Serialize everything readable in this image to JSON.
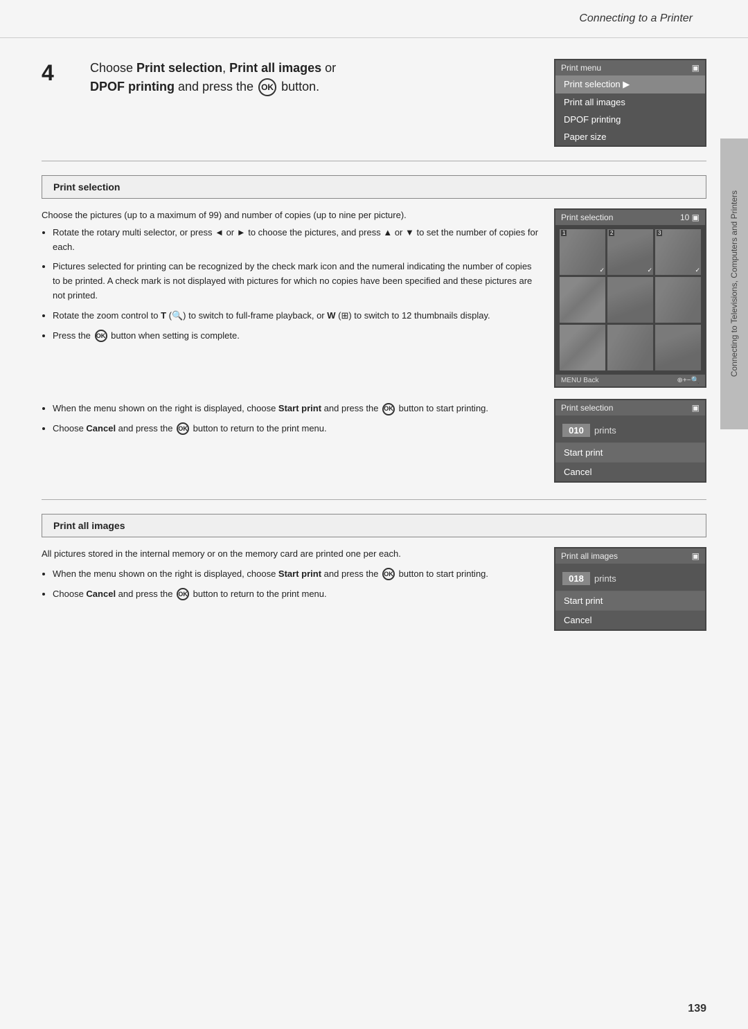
{
  "header": {
    "title": "Connecting to a Printer"
  },
  "right_tab": {
    "text": "Connecting to Televisions, Computers and Printers"
  },
  "step4": {
    "number": "4",
    "text_intro": "Choose ",
    "bold1": "Print selection",
    "comma": ", ",
    "bold2": "Print all images",
    "text_or": " or",
    "bold3": "DPOF printing",
    "text_end": " and press the",
    "ok_symbol": "OK",
    "text_end2": "button."
  },
  "print_menu_screen": {
    "header": "Print menu",
    "items": [
      {
        "label": "Print selection",
        "selected": true,
        "has_arrow": true
      },
      {
        "label": "Print all images",
        "selected": false
      },
      {
        "label": "DPOF printing",
        "selected": false
      },
      {
        "label": "Paper size",
        "selected": false
      }
    ]
  },
  "print_selection_section": {
    "title": "Print selection",
    "description": "Choose the pictures (up to a maximum of 99) and number of copies (up to nine per picture).",
    "bullets": [
      "Rotate the rotary multi selector, or press ◄ or ► to choose the pictures, and press ▲ or ▼ to set the number of copies for each.",
      "Pictures selected for printing can be recognized by the check mark icon and the numeral indicating the number of copies to be printed. A check mark is not displayed with pictures for which no copies have been specified and these pictures are not printed.",
      "Rotate the zoom control to T (🔍) to switch to full-frame playback, or W (🔲) to switch to 12 thumbnails display.",
      "Press the OK button when setting is complete."
    ],
    "thumb_screen": {
      "header_label": "Print selection",
      "count": "10",
      "thumbnails": [
        {
          "num": "1",
          "has_check": true
        },
        {
          "num": "2",
          "has_check": true
        },
        {
          "num": "3",
          "has_check": true
        },
        {
          "num": "",
          "has_check": false
        },
        {
          "num": "",
          "has_check": false
        },
        {
          "num": "",
          "has_check": false
        },
        {
          "num": "",
          "has_check": false
        },
        {
          "num": "",
          "has_check": false
        },
        {
          "num": "",
          "has_check": false
        }
      ],
      "footer_left": "MENU Back",
      "footer_right": "⊕+−🔍"
    }
  },
  "print_selection_confirm": {
    "bullets": [
      "When the menu shown on the right is displayed, choose Start print and press the OK button to start printing.",
      "Choose Cancel and press the OK button to return to the print menu."
    ],
    "screen": {
      "header": "Print selection",
      "prints_value": "010",
      "prints_label": "prints",
      "start_label": "Start print",
      "cancel_label": "Cancel"
    }
  },
  "print_all_section": {
    "title": "Print all images",
    "description": "All pictures stored in the internal memory or on the memory card are printed one per each.",
    "bullets": [
      "When the menu shown on the right is displayed, choose Start print and press the OK button to start printing.",
      "Choose Cancel and press the OK button to return to the print menu."
    ],
    "screen": {
      "header": "Print all images",
      "prints_value": "018",
      "prints_label": "prints",
      "start_label": "Start print",
      "cancel_label": "Cancel"
    }
  },
  "page_number": "139"
}
